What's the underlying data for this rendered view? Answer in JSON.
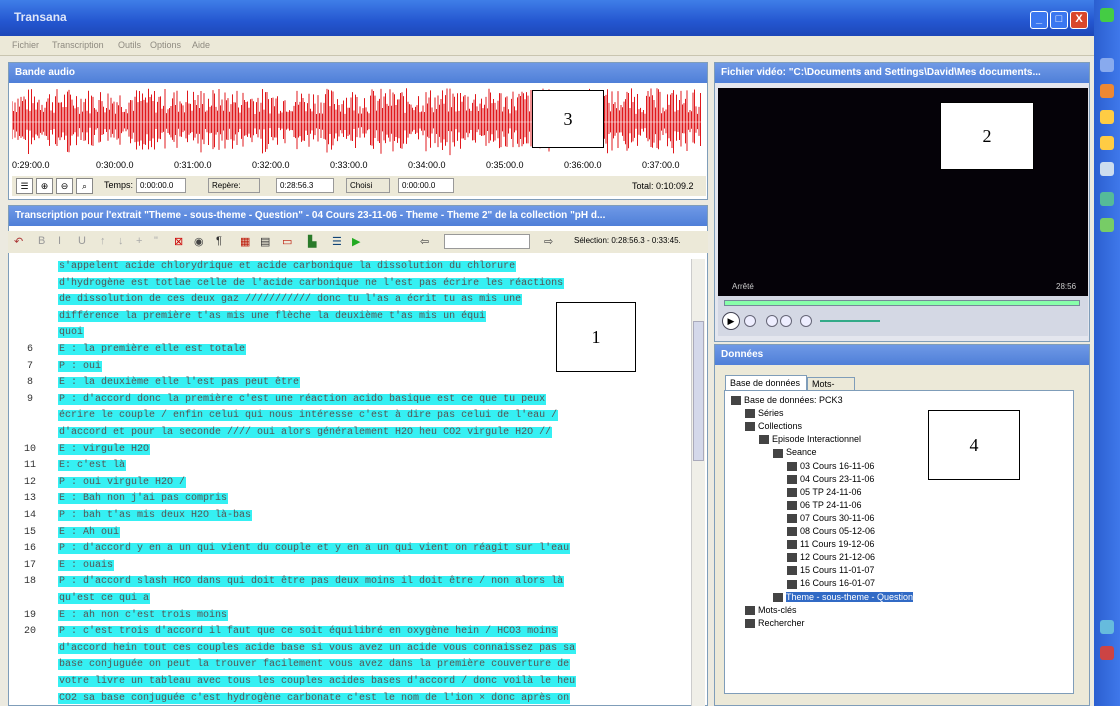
{
  "window": {
    "title": "Transana",
    "min": "_",
    "max": "□",
    "close": "X"
  },
  "menu": [
    "Fichier",
    "Transcription",
    "Outils",
    "Options",
    "Aide"
  ],
  "audio": {
    "header": "Bande audio",
    "ticks": [
      "0:29:00.0",
      "0:30:00.0",
      "0:31:00.0",
      "0:32:00.0",
      "0:33:00.0",
      "0:34:00.0",
      "0:35:00.0",
      "0:36:00.0",
      "0:37:00.0"
    ],
    "temps_label": "Temps:",
    "temps_value": "0:00:00.0",
    "repere_label": "Repère:",
    "repere_value": "0:28:56.3",
    "choisi_label": "Choisi",
    "choisi_value": "0:00:00.0",
    "total": "Total: 0:10:09.2"
  },
  "transcript": {
    "header": "Transcription pour l'extrait \"Theme - sous-theme - Question\" - 04 Cours 23-11-06 - Theme - Theme 2\" de la collection \"pH d...",
    "selection": "Sélection: 0:28:56.3 - 0:33:45.",
    "lines": [
      {
        "n": "",
        "t": "s'appelent acide chlorydrique et acide carbonique la dissolution du chlorure"
      },
      {
        "n": "",
        "t": "d'hydrogène est totlae celle de l'acide carbonique ne l'est pas écrire les réactions"
      },
      {
        "n": "",
        "t": "de dissolution de ces deux gaz /////////// donc tu l'as a écrit tu as mis une"
      },
      {
        "n": "",
        "t": "différence la première t'as mis une flèche la deuxième t'as mis un équi"
      },
      {
        "n": "",
        "t": "quoi"
      },
      {
        "n": "6",
        "t": "E : la première elle est totale"
      },
      {
        "n": "7",
        "t": "P : oui"
      },
      {
        "n": "8",
        "t": "E : la deuxième elle l'est pas peut être"
      },
      {
        "n": "9",
        "t": "P : d'accord donc la première c'est une réaction acido basique est ce que tu peux"
      },
      {
        "n": "",
        "t": "écrire le couple / enfin celui qui nous intéresse c'est à dire pas celui de l'eau /"
      },
      {
        "n": "",
        "t": "d'accord et pour la seconde //// oui alors généralement H2O heu CO2 virgule H2O //"
      },
      {
        "n": "10",
        "t": "E : virgule H2O"
      },
      {
        "n": "11",
        "t": "E: c'est là"
      },
      {
        "n": "12",
        "t": "P : oui virgule H2O /"
      },
      {
        "n": "13",
        "t": "E : Bah non j'ai pas compris"
      },
      {
        "n": "14",
        "t": "P : bah t'as mis deux H2O là-bas"
      },
      {
        "n": "15",
        "t": "E : Ah oui"
      },
      {
        "n": "16",
        "t": "P : d'accord y en a un qui vient du couple et y en a un qui vient on réagit sur l'eau"
      },
      {
        "n": "17",
        "t": "E : ouais"
      },
      {
        "n": "18",
        "t": "P : d'accord slash HCO dans qui doit être pas deux moins il doit être / non alors là"
      },
      {
        "n": "",
        "t": "qu'est ce qui a"
      },
      {
        "n": "19",
        "t": "E : ah non c'est trois moins"
      },
      {
        "n": "20",
        "t": "P : c'est trois d'accord il faut que ce soit équilibré en oxygène hein / HCO3 moins"
      },
      {
        "n": "",
        "t": "d'accord hein tout ces couples acide base si vous avez un acide vous connaissez pas sa"
      },
      {
        "n": "",
        "t": "base conjuguée on peut la trouver facilement vous avez dans la première couverture de"
      },
      {
        "n": "",
        "t": "votre livre un tableau avec tous les couples acides bases d'accord / donc voilà le heu"
      },
      {
        "n": "",
        "t": "CO2 sa base conjuguée c'est hydrogène carbonate c'est le nom de l'ion × donc après on"
      }
    ]
  },
  "video": {
    "header": "Fichier vidéo: \"C:\\Documents and Settings\\David\\Mes documents...",
    "status_left": "Arrêté",
    "status_right": "28:56"
  },
  "donnees": {
    "header": "Données",
    "tabs": [
      "Base de données",
      "Mots-clés"
    ],
    "tree": [
      {
        "d": 0,
        "t": "Base de données: PCK3"
      },
      {
        "d": 1,
        "t": "Séries"
      },
      {
        "d": 1,
        "t": "Collections"
      },
      {
        "d": 2,
        "t": "Episode Interactionnel"
      },
      {
        "d": 3,
        "t": "Seance"
      },
      {
        "d": 4,
        "t": "03 Cours 16-11-06"
      },
      {
        "d": 4,
        "t": "04 Cours 23-11-06"
      },
      {
        "d": 4,
        "t": "05 TP 24-11-06"
      },
      {
        "d": 4,
        "t": "06 TP 24-11-06"
      },
      {
        "d": 4,
        "t": "07 Cours 30-11-06"
      },
      {
        "d": 4,
        "t": "08 Cours 05-12-06"
      },
      {
        "d": 4,
        "t": "11 Cours 19-12-06"
      },
      {
        "d": 4,
        "t": "12 Cours 21-12-06"
      },
      {
        "d": 4,
        "t": "15 Cours 11-01-07"
      },
      {
        "d": 4,
        "t": "16 Cours 16-01-07"
      },
      {
        "d": 3,
        "t": "Theme - sous-theme - Question",
        "sel": true
      },
      {
        "d": 1,
        "t": "Mots-clés"
      },
      {
        "d": 1,
        "t": "Rechercher"
      }
    ]
  },
  "labels": [
    "1",
    "2",
    "3",
    "4"
  ],
  "colors": {
    "highlight": "#35f0f3",
    "wave": "#e0181c",
    "selected": "#316ac5"
  }
}
